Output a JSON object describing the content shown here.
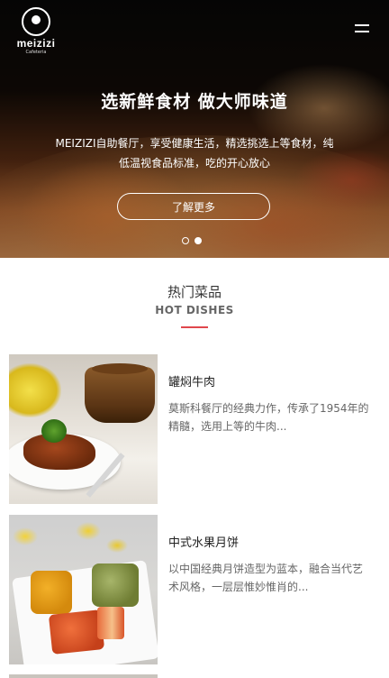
{
  "header": {
    "logo_brand": "meizizi",
    "logo_sub": "Cafeteria",
    "menu_icon": "hamburger-menu-icon"
  },
  "hero": {
    "title": "选新鲜食材  做大师味道",
    "description": "MEIZIZI自助餐厅，享受健康生活，精选挑选上等食材，纯低温视食品标准，吃的开心放心",
    "button_label": "了解更多",
    "carousel_total": 2,
    "carousel_active": 1
  },
  "hot_section": {
    "title": "热门菜品",
    "subtitle": "HOT DISHES",
    "accent_color": "#e0474c"
  },
  "dishes": [
    {
      "name": "罐焖牛肉",
      "description": "莫斯科餐厅的经典力作，传承了1954年的精髓，选用上等的牛肉..."
    },
    {
      "name": "中式水果月饼",
      "description": "以中国经典月饼造型为蓝本，融合当代艺术风格，一层层惟妙惟肖的..."
    }
  ]
}
